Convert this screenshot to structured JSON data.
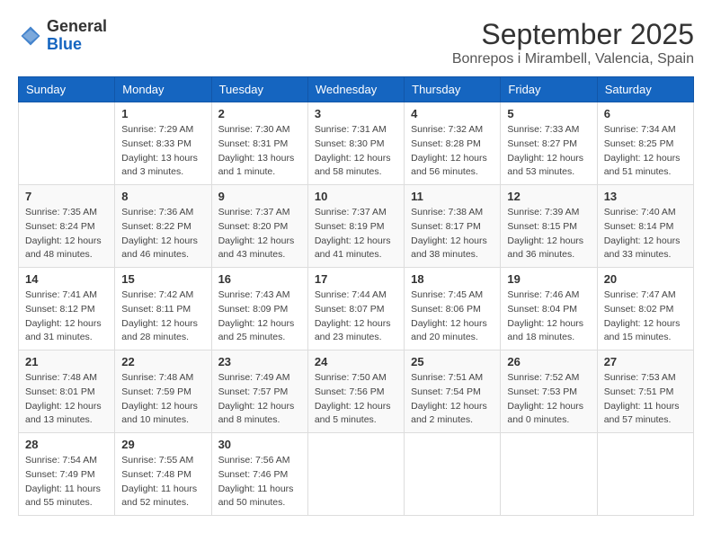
{
  "header": {
    "logo_general": "General",
    "logo_blue": "Blue",
    "month_title": "September 2025",
    "location": "Bonrepos i Mirambell, Valencia, Spain"
  },
  "days_of_week": [
    "Sunday",
    "Monday",
    "Tuesday",
    "Wednesday",
    "Thursday",
    "Friday",
    "Saturday"
  ],
  "weeks": [
    [
      {
        "day": "",
        "sunrise": "",
        "sunset": "",
        "daylight": ""
      },
      {
        "day": "1",
        "sunrise": "Sunrise: 7:29 AM",
        "sunset": "Sunset: 8:33 PM",
        "daylight": "Daylight: 13 hours and 3 minutes."
      },
      {
        "day": "2",
        "sunrise": "Sunrise: 7:30 AM",
        "sunset": "Sunset: 8:31 PM",
        "daylight": "Daylight: 13 hours and 1 minute."
      },
      {
        "day": "3",
        "sunrise": "Sunrise: 7:31 AM",
        "sunset": "Sunset: 8:30 PM",
        "daylight": "Daylight: 12 hours and 58 minutes."
      },
      {
        "day": "4",
        "sunrise": "Sunrise: 7:32 AM",
        "sunset": "Sunset: 8:28 PM",
        "daylight": "Daylight: 12 hours and 56 minutes."
      },
      {
        "day": "5",
        "sunrise": "Sunrise: 7:33 AM",
        "sunset": "Sunset: 8:27 PM",
        "daylight": "Daylight: 12 hours and 53 minutes."
      },
      {
        "day": "6",
        "sunrise": "Sunrise: 7:34 AM",
        "sunset": "Sunset: 8:25 PM",
        "daylight": "Daylight: 12 hours and 51 minutes."
      }
    ],
    [
      {
        "day": "7",
        "sunrise": "Sunrise: 7:35 AM",
        "sunset": "Sunset: 8:24 PM",
        "daylight": "Daylight: 12 hours and 48 minutes."
      },
      {
        "day": "8",
        "sunrise": "Sunrise: 7:36 AM",
        "sunset": "Sunset: 8:22 PM",
        "daylight": "Daylight: 12 hours and 46 minutes."
      },
      {
        "day": "9",
        "sunrise": "Sunrise: 7:37 AM",
        "sunset": "Sunset: 8:20 PM",
        "daylight": "Daylight: 12 hours and 43 minutes."
      },
      {
        "day": "10",
        "sunrise": "Sunrise: 7:37 AM",
        "sunset": "Sunset: 8:19 PM",
        "daylight": "Daylight: 12 hours and 41 minutes."
      },
      {
        "day": "11",
        "sunrise": "Sunrise: 7:38 AM",
        "sunset": "Sunset: 8:17 PM",
        "daylight": "Daylight: 12 hours and 38 minutes."
      },
      {
        "day": "12",
        "sunrise": "Sunrise: 7:39 AM",
        "sunset": "Sunset: 8:15 PM",
        "daylight": "Daylight: 12 hours and 36 minutes."
      },
      {
        "day": "13",
        "sunrise": "Sunrise: 7:40 AM",
        "sunset": "Sunset: 8:14 PM",
        "daylight": "Daylight: 12 hours and 33 minutes."
      }
    ],
    [
      {
        "day": "14",
        "sunrise": "Sunrise: 7:41 AM",
        "sunset": "Sunset: 8:12 PM",
        "daylight": "Daylight: 12 hours and 31 minutes."
      },
      {
        "day": "15",
        "sunrise": "Sunrise: 7:42 AM",
        "sunset": "Sunset: 8:11 PM",
        "daylight": "Daylight: 12 hours and 28 minutes."
      },
      {
        "day": "16",
        "sunrise": "Sunrise: 7:43 AM",
        "sunset": "Sunset: 8:09 PM",
        "daylight": "Daylight: 12 hours and 25 minutes."
      },
      {
        "day": "17",
        "sunrise": "Sunrise: 7:44 AM",
        "sunset": "Sunset: 8:07 PM",
        "daylight": "Daylight: 12 hours and 23 minutes."
      },
      {
        "day": "18",
        "sunrise": "Sunrise: 7:45 AM",
        "sunset": "Sunset: 8:06 PM",
        "daylight": "Daylight: 12 hours and 20 minutes."
      },
      {
        "day": "19",
        "sunrise": "Sunrise: 7:46 AM",
        "sunset": "Sunset: 8:04 PM",
        "daylight": "Daylight: 12 hours and 18 minutes."
      },
      {
        "day": "20",
        "sunrise": "Sunrise: 7:47 AM",
        "sunset": "Sunset: 8:02 PM",
        "daylight": "Daylight: 12 hours and 15 minutes."
      }
    ],
    [
      {
        "day": "21",
        "sunrise": "Sunrise: 7:48 AM",
        "sunset": "Sunset: 8:01 PM",
        "daylight": "Daylight: 12 hours and 13 minutes."
      },
      {
        "day": "22",
        "sunrise": "Sunrise: 7:48 AM",
        "sunset": "Sunset: 7:59 PM",
        "daylight": "Daylight: 12 hours and 10 minutes."
      },
      {
        "day": "23",
        "sunrise": "Sunrise: 7:49 AM",
        "sunset": "Sunset: 7:57 PM",
        "daylight": "Daylight: 12 hours and 8 minutes."
      },
      {
        "day": "24",
        "sunrise": "Sunrise: 7:50 AM",
        "sunset": "Sunset: 7:56 PM",
        "daylight": "Daylight: 12 hours and 5 minutes."
      },
      {
        "day": "25",
        "sunrise": "Sunrise: 7:51 AM",
        "sunset": "Sunset: 7:54 PM",
        "daylight": "Daylight: 12 hours and 2 minutes."
      },
      {
        "day": "26",
        "sunrise": "Sunrise: 7:52 AM",
        "sunset": "Sunset: 7:53 PM",
        "daylight": "Daylight: 12 hours and 0 minutes."
      },
      {
        "day": "27",
        "sunrise": "Sunrise: 7:53 AM",
        "sunset": "Sunset: 7:51 PM",
        "daylight": "Daylight: 11 hours and 57 minutes."
      }
    ],
    [
      {
        "day": "28",
        "sunrise": "Sunrise: 7:54 AM",
        "sunset": "Sunset: 7:49 PM",
        "daylight": "Daylight: 11 hours and 55 minutes."
      },
      {
        "day": "29",
        "sunrise": "Sunrise: 7:55 AM",
        "sunset": "Sunset: 7:48 PM",
        "daylight": "Daylight: 11 hours and 52 minutes."
      },
      {
        "day": "30",
        "sunrise": "Sunrise: 7:56 AM",
        "sunset": "Sunset: 7:46 PM",
        "daylight": "Daylight: 11 hours and 50 minutes."
      },
      {
        "day": "",
        "sunrise": "",
        "sunset": "",
        "daylight": ""
      },
      {
        "day": "",
        "sunrise": "",
        "sunset": "",
        "daylight": ""
      },
      {
        "day": "",
        "sunrise": "",
        "sunset": "",
        "daylight": ""
      },
      {
        "day": "",
        "sunrise": "",
        "sunset": "",
        "daylight": ""
      }
    ]
  ]
}
